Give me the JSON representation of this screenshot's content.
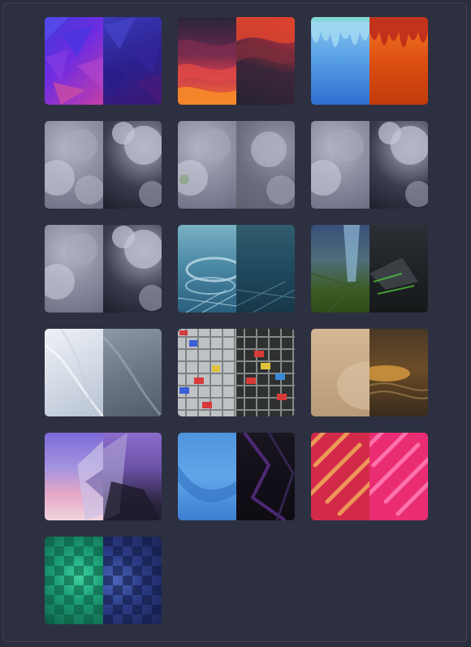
{
  "wallpaper_grid": {
    "items": [
      {
        "name": "geometric-purple-wallpaper-icon"
      },
      {
        "name": "wavy-red-wallpaper-icon"
      },
      {
        "name": "drip-blue-orange-wallpaper-icon"
      },
      {
        "name": "clouds-wallpaper-icon"
      },
      {
        "name": "clouds-green-wallpaper-icon"
      },
      {
        "name": "clouds-wallpaper-icon"
      },
      {
        "name": "clouds-wallpaper-icon"
      },
      {
        "name": "teal-swirl-wallpaper-icon"
      },
      {
        "name": "green-crystal-wallpaper-icon"
      },
      {
        "name": "white-silk-wallpaper-icon"
      },
      {
        "name": "keyboard-keys-wallpaper-icon"
      },
      {
        "name": "bronze-wave-wallpaper-icon"
      },
      {
        "name": "purple-sky-crystal-wallpaper-icon"
      },
      {
        "name": "blue-ribbon-wallpaper-icon"
      },
      {
        "name": "pink-pills-wallpaper-icon"
      },
      {
        "name": "green-blue-checker-wallpaper-icon"
      }
    ]
  },
  "colors": {
    "background": "#2b2e3d",
    "panel": "#2d3041",
    "panel_border": "#3f4356"
  }
}
